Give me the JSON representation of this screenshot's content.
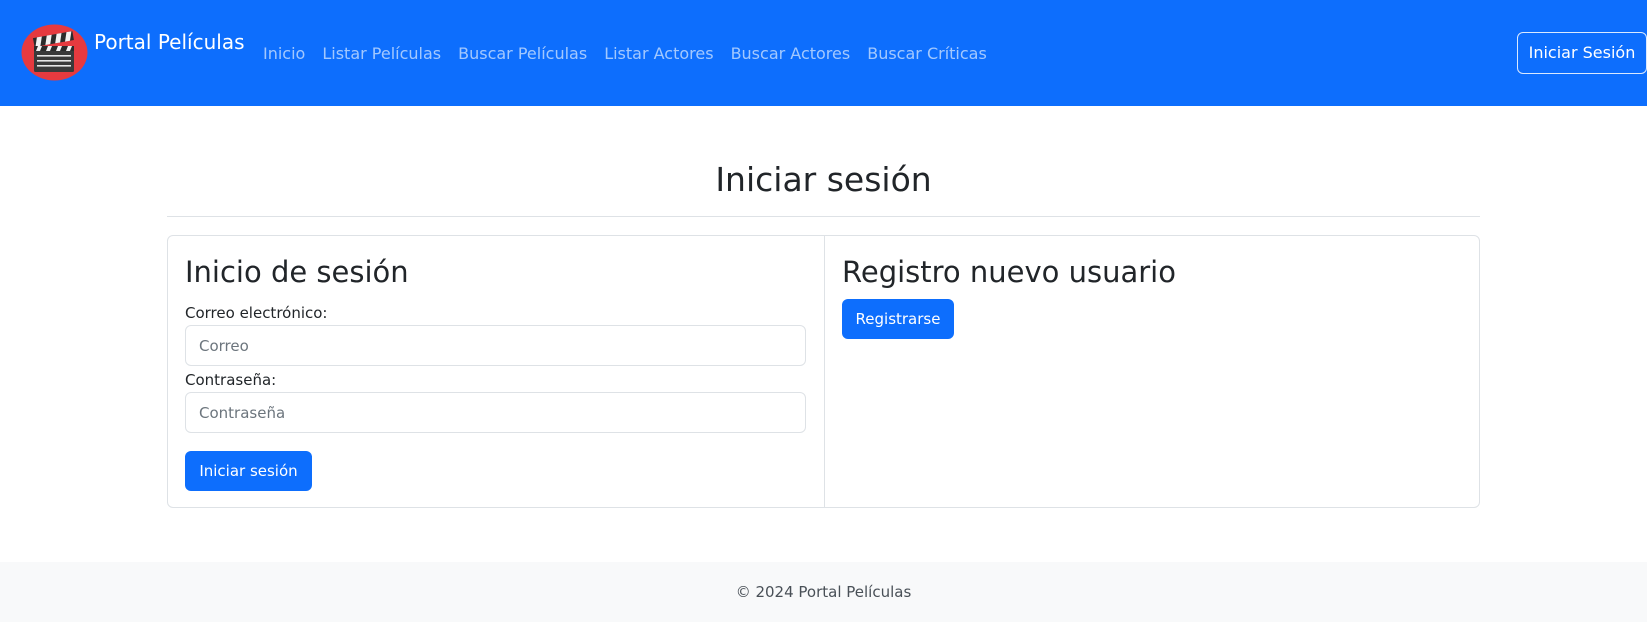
{
  "navbar": {
    "brand": "Portal Películas",
    "logo_icon": "clapperboard-icon",
    "links": [
      "Inicio",
      "Listar Películas",
      "Buscar Películas",
      "Listar Actores",
      "Buscar Actores",
      "Buscar Críticas"
    ],
    "login_button": "Iniciar Sesión",
    "background_color": "#0d6efd"
  },
  "page_title": "Iniciar sesión",
  "login_section": {
    "title": "Inicio de sesión",
    "email_label": "Correo electrónico:",
    "email_placeholder": "Correo",
    "password_label": "Contraseña:",
    "password_placeholder": "Contraseña",
    "submit_label": "Iniciar sesión"
  },
  "register_section": {
    "title": "Registro nuevo usuario",
    "button_label": "Registrarse"
  },
  "footer": {
    "text": "© 2024 Portal Películas"
  },
  "colors": {
    "primary": "#0d6efd",
    "footer_bg": "#f8f9fa",
    "border": "#dee2e6"
  }
}
